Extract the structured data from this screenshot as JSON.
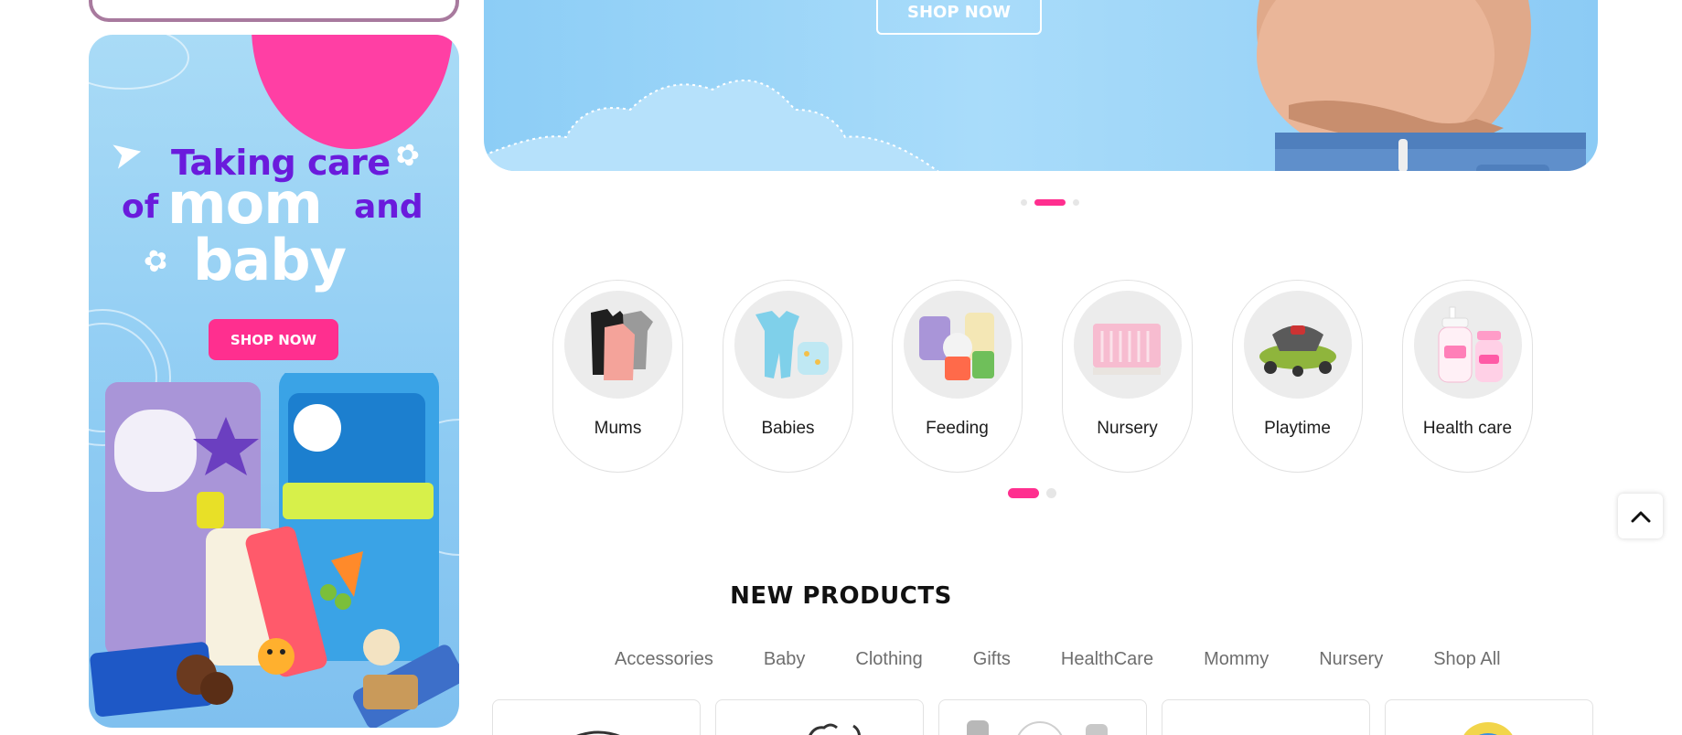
{
  "side_banner": {
    "headline_line1": "Taking care",
    "headline_of": "of",
    "headline_mom": "mom",
    "headline_and": "and",
    "headline_baby": "baby",
    "shop_label": "SHOP NOW"
  },
  "hero": {
    "shop_label": "SHOP NOW"
  },
  "categories": [
    {
      "label": "Mums",
      "icon": "maternity-clothing-icon"
    },
    {
      "label": "Babies",
      "icon": "baby-clothing-icon"
    },
    {
      "label": "Feeding",
      "icon": "baby-food-icon"
    },
    {
      "label": "Nursery",
      "icon": "crib-icon"
    },
    {
      "label": "Playtime",
      "icon": "baby-walker-icon"
    },
    {
      "label": "Health care",
      "icon": "baby-lotion-icon"
    }
  ],
  "new_products": {
    "title": "NEW PRODUCTS",
    "tabs": [
      "Accessories",
      "Baby",
      "Clothing",
      "Gifts",
      "HealthCare",
      "Mommy",
      "Nursery",
      "Shop All"
    ]
  },
  "colors": {
    "accent": "#ff2f8f",
    "purple": "#6a1bdc",
    "sky": "#a9dcfa"
  }
}
